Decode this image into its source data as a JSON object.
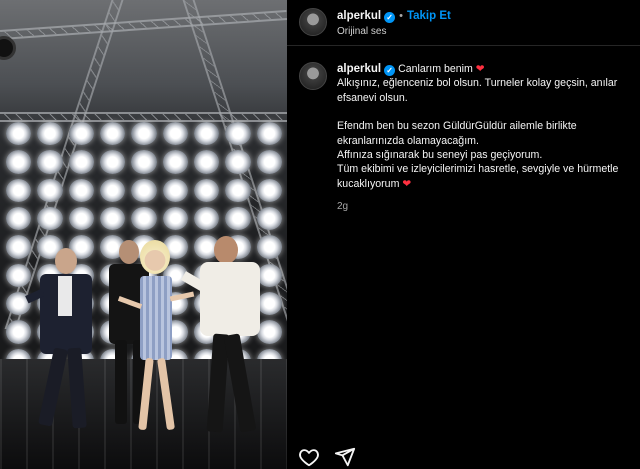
{
  "post": {
    "username": "alperkul",
    "follow_label": "Takip Et",
    "separator": "•",
    "audio": "Orijinal ses"
  },
  "caption": {
    "username": "alperkul",
    "lines": [
      "Canlarım benim",
      "Alkışınız, eğlenceniz bol olsun. Turneler kolay geçsin, anılar efsanevi olsun.",
      "Efendm ben bu sezon GüldürGüldür ailemle birlikte ekranlarınızda olamayacağım.",
      "Affınıza sığınarak bu seneyi pas geçiyorum.",
      "Tüm ekibimi ve izleyicilerimizi hasretle, sevgiyle ve hürmetle kucaklıyorum"
    ],
    "time": "2g"
  },
  "icons": {
    "verified": "verified-badge-icon",
    "heart": "heart-icon",
    "like": "like-icon",
    "share": "share-icon"
  },
  "colors": {
    "accent": "#0095f6",
    "heart": "#ff3040",
    "background": "#000000"
  }
}
